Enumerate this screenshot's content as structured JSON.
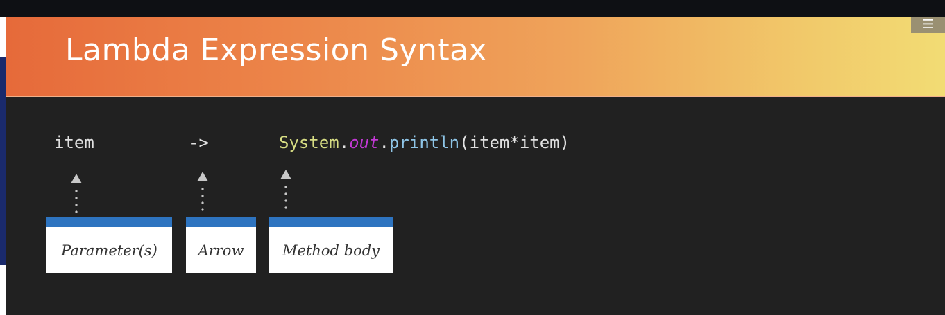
{
  "slide": {
    "title": "Lambda Expression Syntax",
    "menu_icon": "hamburger-menu-icon"
  },
  "code": {
    "parameter": "item",
    "arrow": "->",
    "body": {
      "class_name": "System",
      "dot1": ".",
      "field": "out",
      "dot2": ".",
      "method": "println",
      "args": "(item*item)"
    }
  },
  "labels": {
    "parameter": "Parameter(s)",
    "arrow": "Arrow",
    "method_body": "Method body"
  },
  "colors": {
    "banner_start": "#e66a3a",
    "banner_end": "#f2dc74",
    "slide_background": "#212121",
    "label_accent": "#2e74c0",
    "code_class": "#d8de84",
    "code_field": "#c238d4",
    "code_method": "#8fc6e8"
  }
}
